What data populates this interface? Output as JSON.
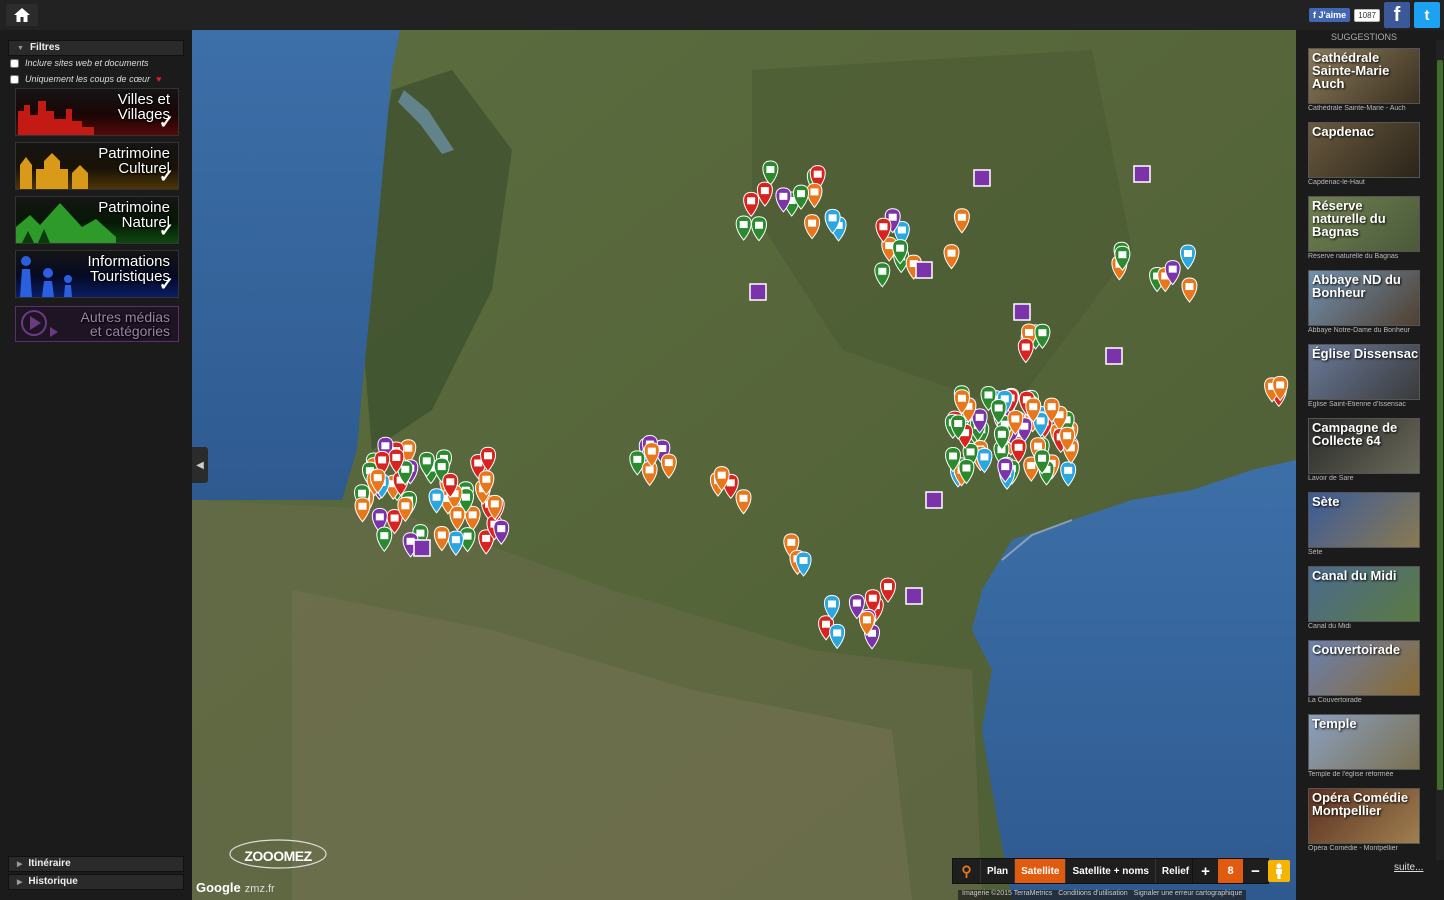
{
  "topbar": {
    "home_icon": "home-icon",
    "like_label": "J'aime",
    "like_count": "1087"
  },
  "sidebar": {
    "filters_title": "Filtres",
    "option_web": "Inclure sites web et documents",
    "option_favorites": "Uniquement les coups de cœur",
    "categories": [
      {
        "line1": "Villes et",
        "line2": "Villages"
      },
      {
        "line1": "Patrimoine",
        "line2": "Culturel"
      },
      {
        "line1": "Patrimoine",
        "line2": "Naturel"
      },
      {
        "line1": "Informations",
        "line2": "Touristiques"
      },
      {
        "line1": "Autres médias",
        "line2": "et catégories"
      }
    ],
    "itinerary": "Itinéraire",
    "history": "Historique",
    "logo": "ZOOOMEZ",
    "logo_url": "zmz.fr"
  },
  "map": {
    "types": [
      "Plan",
      "Satellite",
      "Satellite + noms",
      "Relief"
    ],
    "active_type": "Satellite",
    "zoom_level": "8",
    "zoom_in": "+",
    "zoom_out": "−",
    "google": "Google",
    "footer": [
      "Imagerie ©2015 TerraMetrics",
      "Conditions d'utilisation",
      "Signaler une erreur cartographique"
    ],
    "colors": {
      "village": "#d8241e",
      "culture": "#e8771c",
      "nature": "#2c8a2e",
      "info": "#2aa6e0",
      "other": "#7a33a8"
    }
  },
  "suggestions": {
    "title": "SUGGESTIONS",
    "items": [
      {
        "title": "Cathédrale Sainte-Marie Auch",
        "caption": "Cathédrale Sainte-Marie - Auch"
      },
      {
        "title": "Capdenac",
        "caption": "Capdenac-le-Haut"
      },
      {
        "title": "Réserve naturelle du Bagnas",
        "caption": "Réserve naturelle du Bagnas"
      },
      {
        "title": "Abbaye ND du Bonheur",
        "caption": "Abbaye Notre-Dame du Bonheur"
      },
      {
        "title": "Église Dissensac",
        "caption": "Eglise Saint-Etienne d'Issensac"
      },
      {
        "title": "Campagne de Collecte 64",
        "caption": "Lavoir de Sare"
      },
      {
        "title": "Sète",
        "caption": "Sète"
      },
      {
        "title": "Canal du Midi",
        "caption": "Canal du Midi"
      },
      {
        "title": "Couvertoirade",
        "caption": "La Couvertoirade"
      },
      {
        "title": "Temple",
        "caption": "Temple de l'église réformée"
      },
      {
        "title": "Opéra Comédie Montpellier",
        "caption": "Opéra Comédie - Montpellier"
      }
    ],
    "more": "suite..."
  }
}
